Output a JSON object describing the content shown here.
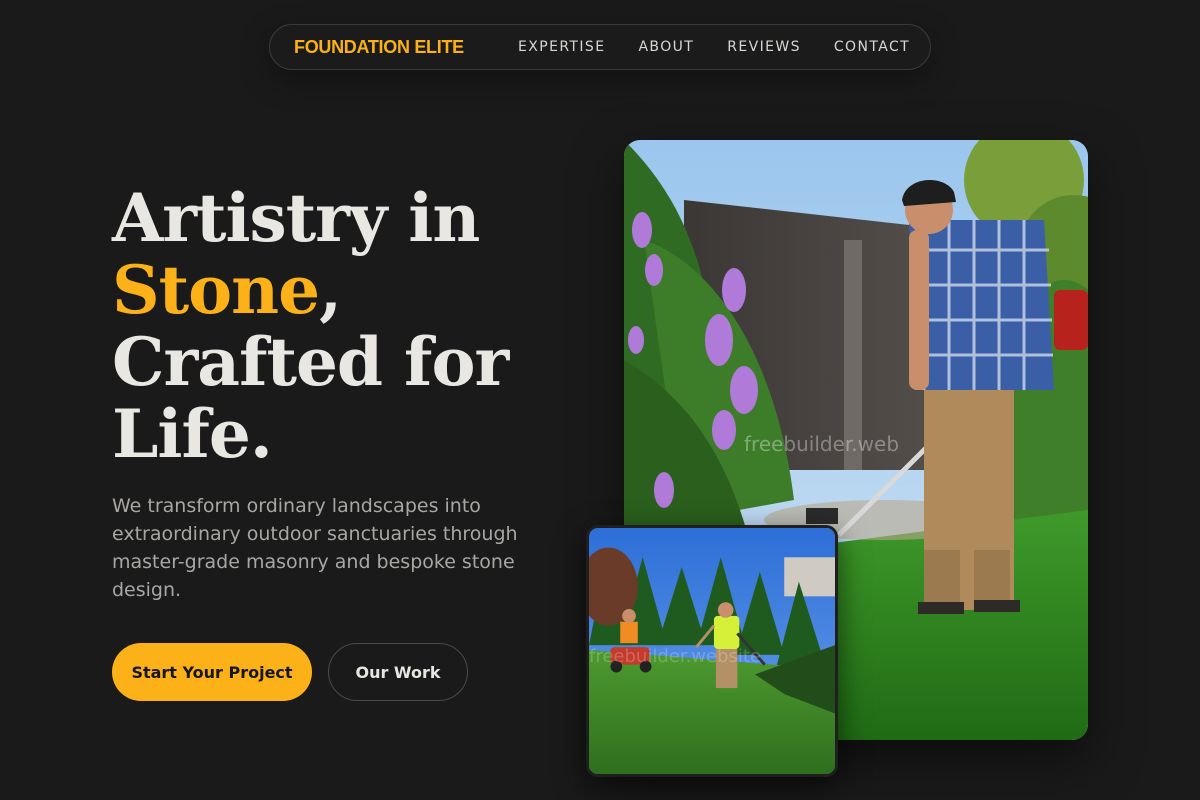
{
  "nav": {
    "brand": "FOUNDATION ELITE",
    "links": [
      "EXPERTISE",
      "ABOUT",
      "REVIEWS",
      "CONTACT"
    ]
  },
  "hero": {
    "headline_part1": "Artistry in",
    "headline_accent": "Stone",
    "headline_comma": ",",
    "headline_part2": "Crafted for",
    "headline_part3": "Life.",
    "description": "We transform ordinary landscapes into extraordinary outdoor sanctuaries through master-grade masonry and bespoke stone design.",
    "primary_cta": "Start Your Project",
    "secondary_cta": "Our Work"
  },
  "images": {
    "main_watermark": "freebuilder.web",
    "small_watermark": "freebuilder.website"
  },
  "colors": {
    "background": "#1a1a1a",
    "accent": "#fbb117",
    "text": "#e9e7e2",
    "muted_text": "#a9a7a3"
  }
}
